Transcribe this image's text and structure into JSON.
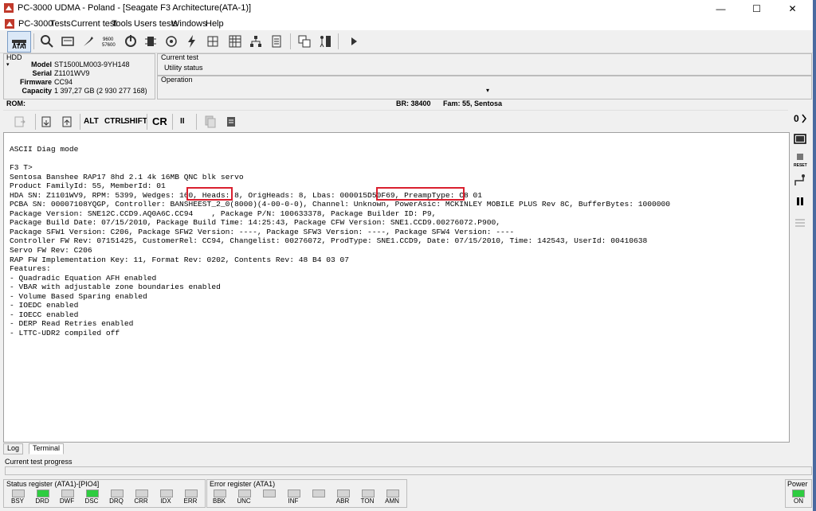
{
  "window": {
    "title": "PC-3000 UDMA - Poland - [Seagate F3 Architecture(ATA-1)]",
    "controls": {
      "minimize": "—",
      "maximize": "☐",
      "close": "✕"
    }
  },
  "menu": [
    "PC-3000",
    "Tests",
    "Current test",
    "Tools",
    "Users tests",
    "Windows",
    "Help"
  ],
  "toolbar": {
    "atai_label": "ATAI"
  },
  "hdd": {
    "header": "HDD",
    "fields": [
      {
        "label": "Model",
        "value": "ST1500LM003-9YH148"
      },
      {
        "label": "Serial",
        "value": "Z1101WV9"
      },
      {
        "label": "Firmware",
        "value": "CC94"
      },
      {
        "label": "Capacity",
        "value": "1 397,27 GB (2 930 277 168)"
      }
    ]
  },
  "current_test": {
    "title": "Current test",
    "value": "Utility status"
  },
  "operation": {
    "title": "Operation"
  },
  "rom_bar": {
    "rom": "ROM:",
    "br": "BR: 38400",
    "fam": "Fam: 55, Sentosa"
  },
  "terminal_toolbar": {
    "alt": "ALT",
    "ctrl": "CTRL",
    "shift": "SHIFT",
    "cr": "CR",
    "pause": "II"
  },
  "terminal": {
    "lines": [
      "ASCII Diag mode",
      "",
      "F3 T>",
      "Sentosa Banshee RAP17 8hd 2.1 4k 16MB QNC blk servo",
      "Product FamilyId: 55, MemberId: 01",
      "HDA SN: Z1101WV9, RPM: 5399, Wedges: 160, Heads: 8, OrigHeads: 8, Lbas: 000015D50F69, PreampType: C8 01",
      "PCBA SN: 00007108YQGP, Controller: BANSHEEST_2_0(8000)(4-00-0-0), Channel: Unknown, PowerAsic: MCKINLEY MOBILE PLUS Rev 8C, BufferBytes: 1000000",
      "Package Version: SNE12C.CCD9.AQ0A6C.CC94    , Package P/N: 100633378, Package Builder ID: P9,",
      "Package Build Date: 07/15/2010, Package Build Time: 14:25:43, Package CFW Version: SNE1.CCD9.00276072.P900,",
      "Package SFW1 Version: C206, Package SFW2 Version: ----, Package SFW3 Version: ----, Package SFW4 Version: ----",
      "Controller FW Rev: 07151425, CustomerRel: CC94, Changelist: 00276072, ProdType: SNE1.CCD9, Date: 07/15/2010, Time: 142543, UserId: 00410638",
      "Servo FW Rev: C206",
      "RAP FW Implementation Key: 11, Format Rev: 0202, Contents Rev: 48 B4 03 07",
      "Features:",
      "- Quadradic Equation AFH enabled",
      "- VBAR with adjustable zone boundaries enabled",
      "- Volume Based Sparing enabled",
      "- IOEDC enabled",
      "- IOECC enabled",
      "- DERP Read Retries enabled",
      "- LTTC-UDR2 compiled off"
    ]
  },
  "tabs": [
    {
      "label": "Log"
    },
    {
      "label": "Terminal",
      "active": true
    }
  ],
  "progress": {
    "label": "Current test progress"
  },
  "status_register": {
    "title": "Status register (ATA1)-[PIO4]",
    "leds": [
      {
        "label": "BSY",
        "on": false
      },
      {
        "label": "DRD",
        "on": true
      },
      {
        "label": "DWF",
        "on": false
      },
      {
        "label": "DSC",
        "on": true
      },
      {
        "label": "DRQ",
        "on": false
      },
      {
        "label": "CRR",
        "on": false
      },
      {
        "label": "IDX",
        "on": false
      },
      {
        "label": "ERR",
        "on": false
      }
    ]
  },
  "error_register": {
    "title": "Error register (ATA1)",
    "leds": [
      {
        "label": "BBK",
        "on": false
      },
      {
        "label": "UNC",
        "on": false
      },
      {
        "label": "",
        "on": false
      },
      {
        "label": "INF",
        "on": false
      },
      {
        "label": "",
        "on": false
      },
      {
        "label": "ABR",
        "on": false
      },
      {
        "label": "TON",
        "on": false
      },
      {
        "label": "AMN",
        "on": false
      }
    ]
  },
  "power": {
    "title": "Power",
    "label": "ON",
    "on": true
  },
  "colors": {
    "highlight": "#d9202f",
    "led_on": "#2ecc40",
    "led_off": "#d4d4d4"
  }
}
